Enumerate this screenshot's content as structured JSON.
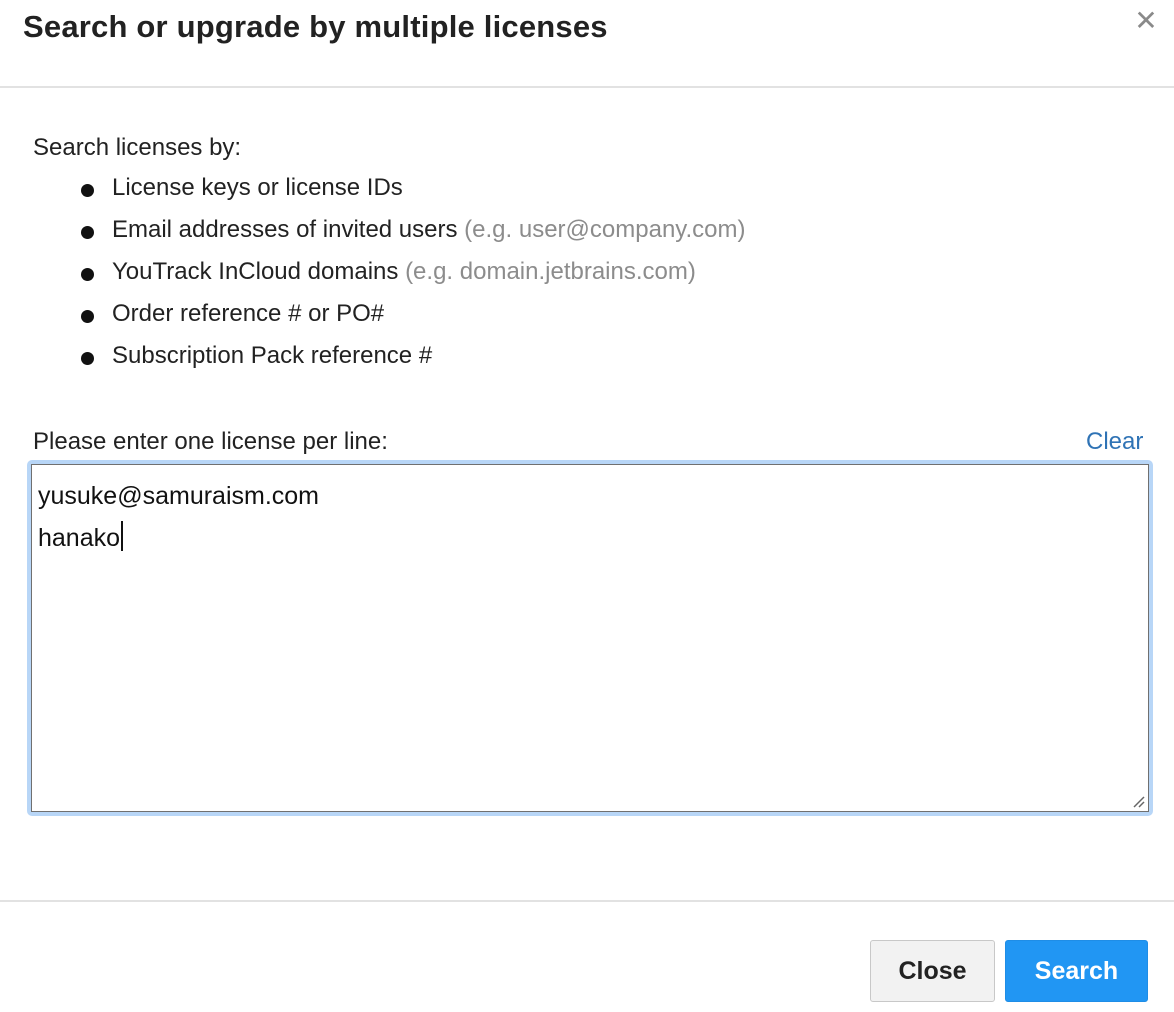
{
  "dialog": {
    "title": "Search or upgrade by multiple licenses",
    "close_icon": "close-icon"
  },
  "criteria": {
    "intro": "Search licenses by:",
    "items": [
      {
        "text": "License keys or license IDs",
        "hint": ""
      },
      {
        "text": "Email addresses of invited users",
        "hint": "(e.g. user@company.com)"
      },
      {
        "text": "YouTrack InCloud domains",
        "hint": "(e.g. domain.jetbrains.com)"
      },
      {
        "text": "Order reference # or PO#",
        "hint": ""
      },
      {
        "text": "Subscription Pack reference #",
        "hint": ""
      }
    ]
  },
  "license_input": {
    "label": "Please enter one license per line:",
    "clear_label": "Clear",
    "lines": [
      "yusuke@samuraism.com",
      "hanako"
    ]
  },
  "footer": {
    "close_label": "Close",
    "search_label": "Search"
  },
  "colors": {
    "link": "#2f73b5",
    "primary_button": "#2196f3",
    "focus_ring": "#b8d6f7",
    "hint_text": "#8c8c8c"
  }
}
